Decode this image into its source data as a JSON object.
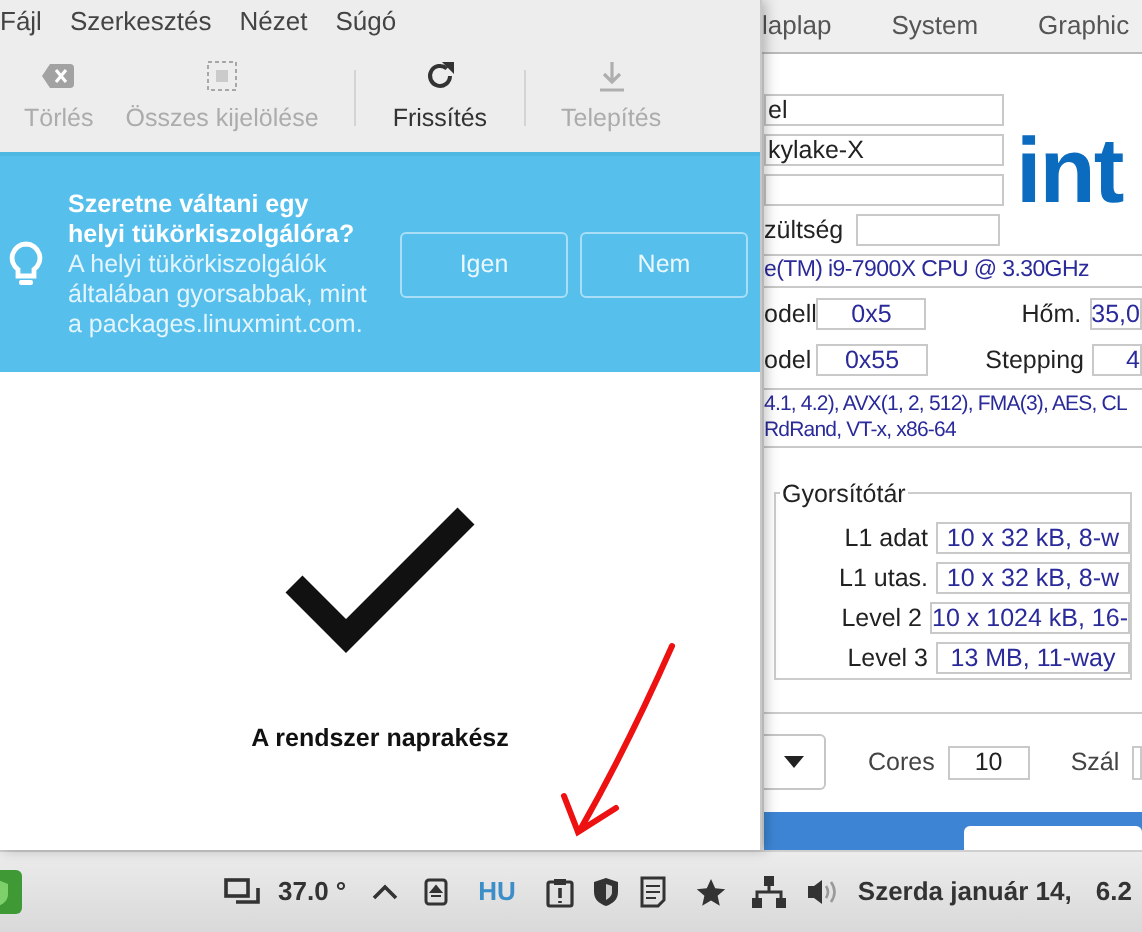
{
  "menu": [
    "Fájl",
    "Szerkesztés",
    "Nézet",
    "Súgó"
  ],
  "toolbar": [
    [
      {
        "label": "Törlés",
        "disabled": true
      },
      {
        "label": "Összes kijelölése",
        "disabled": true
      }
    ],
    [
      {
        "label": "Frissítés",
        "disabled": false
      }
    ],
    [
      {
        "label": "Telepítés",
        "disabled": true
      }
    ]
  ],
  "banner": {
    "title": "Szeretne váltani egy helyi tükörkiszolgálóra?",
    "message": "A helyi tükörkiszolgálók általában gyorsabbak, mint a packages.linuxmint.com.",
    "buttons": [
      "Igen",
      "Nem"
    ]
  },
  "status_message": "A rendszer naprakész",
  "cpu_window": {
    "tabs": [
      {
        "label": "laplap",
        "selected": false
      },
      {
        "label": "System",
        "selected": false
      },
      {
        "label": "Graphic",
        "selected": false
      }
    ],
    "name_fields": [
      "el",
      "kylake-X"
    ],
    "voltage_label": "zültség",
    "logo": "int",
    "spec": "e(TM) i9-7900X CPU @ 3.30GHz",
    "rows": [
      {
        "label": "odell",
        "value": "0x5",
        "label2": "Hőm.",
        "value2": "35,0"
      },
      {
        "label": "odel",
        "value": "0x55",
        "label2": "Stepping",
        "value2": "4"
      }
    ],
    "instructions": [
      "4.1, 4.2), AVX(1, 2, 512), FMA(3), AES, CL",
      "RdRand, VT-x, x86-64"
    ],
    "cache": {
      "title": "Gyorsítótár",
      "rows": [
        {
          "label": "L1 adat",
          "value": "10 x   32 kB, 8-w"
        },
        {
          "label": "L1 utas.",
          "value": "10 x   32 kB, 8-w"
        },
        {
          "label": "Level 2",
          "value": "10 x 1024 kB, 16-"
        },
        {
          "label": "Level 3",
          "value": "13 MB, 11-way"
        }
      ]
    },
    "cores_label": "Cores",
    "cores": "10",
    "threads_label": "Szál"
  },
  "taskbar": {
    "temperature": "37.0 °",
    "keyboard": "HU",
    "clock": "Szerda január 14,",
    "clock_2": "6.2"
  }
}
